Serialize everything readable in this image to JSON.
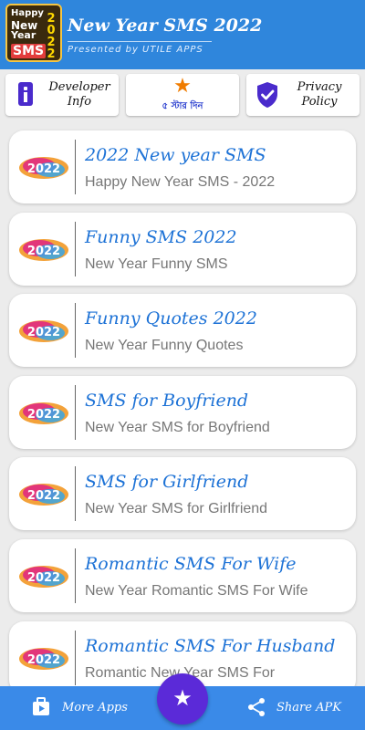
{
  "header": {
    "logo": {
      "line1": "Happy",
      "line2": "New",
      "line3": "Year",
      "badge": "SMS",
      "year_digits": "2022"
    },
    "title": "New Year SMS 2022",
    "subtitle": "Presented by UTILE APPS"
  },
  "top_buttons": {
    "developer": {
      "line1": "Developer",
      "line2": "Info",
      "icon": "info-icon"
    },
    "rate": {
      "label": "৫ স্টার দিন",
      "icon": "star-icon",
      "color": "#f07c00"
    },
    "privacy": {
      "line1": "Privacy",
      "line2": "Policy",
      "icon": "shield-check-icon"
    }
  },
  "list": [
    {
      "badge": "2022",
      "title": "2022 New year SMS",
      "subtitle": "Happy New Year SMS - 2022"
    },
    {
      "badge": "2022",
      "title": "Funny SMS 2022",
      "subtitle": "New Year Funny SMS"
    },
    {
      "badge": "2022",
      "title": "Funny Quotes 2022",
      "subtitle": "New Year Funny Quotes"
    },
    {
      "badge": "2022",
      "title": "SMS for Boyfriend",
      "subtitle": "New Year SMS for Boyfriend"
    },
    {
      "badge": "2022",
      "title": "SMS for Girlfriend",
      "subtitle": "New Year SMS for Girlfriend"
    },
    {
      "badge": "2022",
      "title": "Romantic SMS For Wife",
      "subtitle": "New Year Romantic SMS For Wife"
    },
    {
      "badge": "2022",
      "title": "Romantic SMS For Husband",
      "subtitle": "Romantic New Year SMS For"
    }
  ],
  "bottom_bar": {
    "more_apps": "More Apps",
    "share_apk": "Share APK",
    "fab_icon": "star-icon"
  },
  "colors": {
    "primary": "#2f86dc",
    "accent": "#5b2ad8",
    "title_blue": "#1d72d6",
    "bottom_bar": "#3a8ae8"
  }
}
